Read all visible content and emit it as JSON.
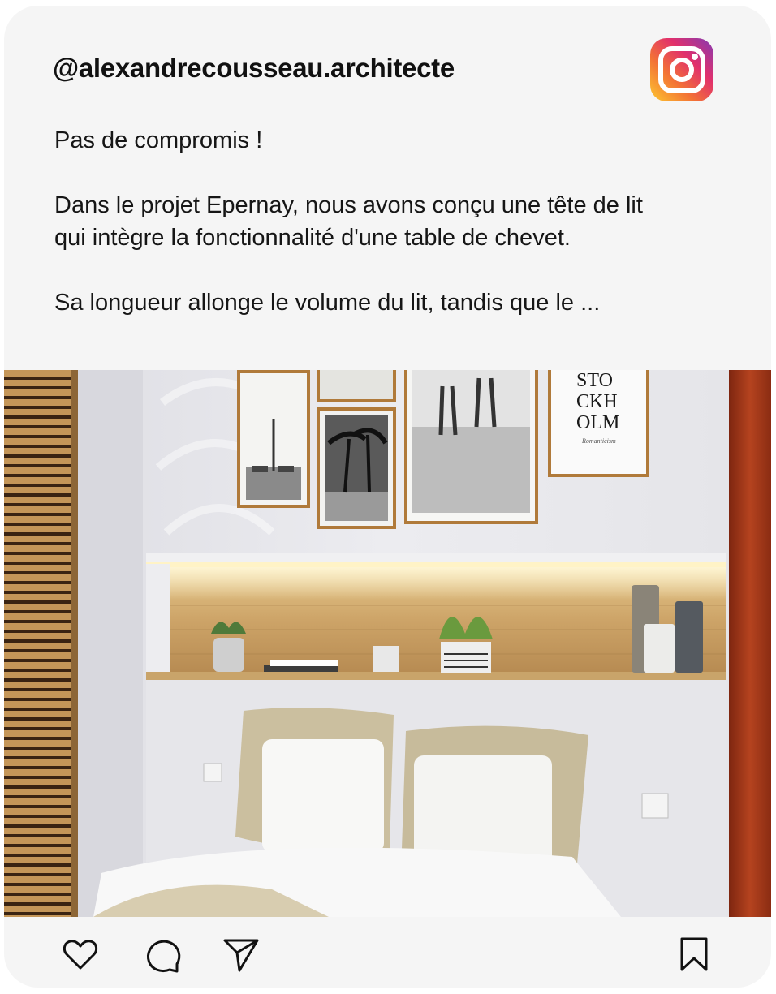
{
  "post": {
    "username": "@alexandrecousseau.architecte",
    "caption": [
      "Pas de compromis !",
      "",
      "Dans le projet Epernay, nous avons conçu une tête de lit",
      "qui intègre la fonctionnalité d'une table de chevet.",
      "",
      "Sa longueur allonge le volume du lit, tandis que le ..."
    ],
    "poster_text": [
      "STO",
      "CKH",
      "OLM",
      "Romanticism"
    ]
  },
  "icons": {
    "brand": "instagram-icon",
    "like": "heart-icon",
    "comment": "comment-icon",
    "share": "send-icon",
    "save": "bookmark-icon"
  },
  "colors": {
    "background": "#f5f5f5",
    "text": "#161616",
    "wood": "#c9a46a",
    "curtain": "#a83a1c"
  }
}
